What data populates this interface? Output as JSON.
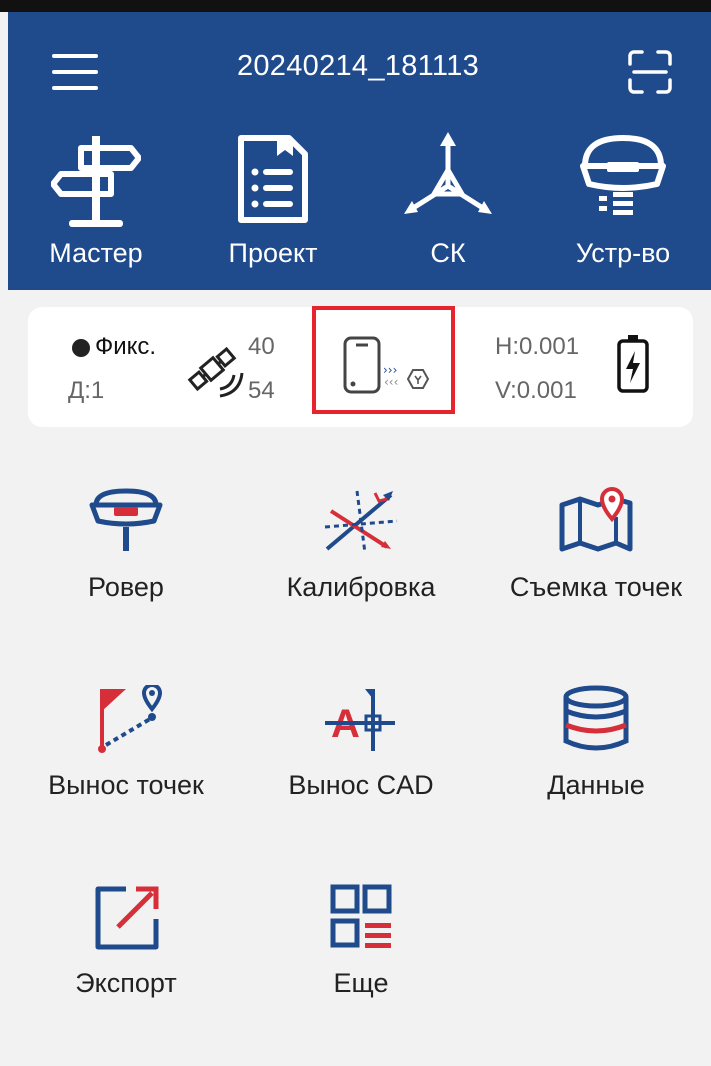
{
  "header": {
    "title": "20240214_181113",
    "nav": [
      {
        "label": "Мастер",
        "icon": "signpost-icon"
      },
      {
        "label": "Проект",
        "icon": "document-list-icon"
      },
      {
        "label": "СК",
        "icon": "coordinate-axes-icon"
      },
      {
        "label": "Устр-во",
        "icon": "gnss-receiver-icon"
      }
    ]
  },
  "status": {
    "fix_label": "Фикс.",
    "diff_age": "Д:1",
    "sat_used": "40",
    "sat_total": "54",
    "h_precision": "H:0.001",
    "v_precision": "V:0.001"
  },
  "menu": {
    "items": [
      {
        "label": "Ровер",
        "icon": "rover-icon"
      },
      {
        "label": "Калибровка",
        "icon": "calibration-icon"
      },
      {
        "label": "Съемка точек",
        "icon": "survey-map-icon"
      },
      {
        "label": "Вынос точек",
        "icon": "stakeout-points-icon"
      },
      {
        "label": "Вынос CAD",
        "icon": "stakeout-cad-icon"
      },
      {
        "label": "Данные",
        "icon": "database-icon"
      },
      {
        "label": "Экспорт",
        "icon": "export-icon"
      },
      {
        "label": "Еще",
        "icon": "more-grid-icon"
      }
    ]
  },
  "colors": {
    "header_bg": "#1f4a8c",
    "accent_red": "#d62f3a",
    "icon_blue": "#1f4a8c"
  }
}
